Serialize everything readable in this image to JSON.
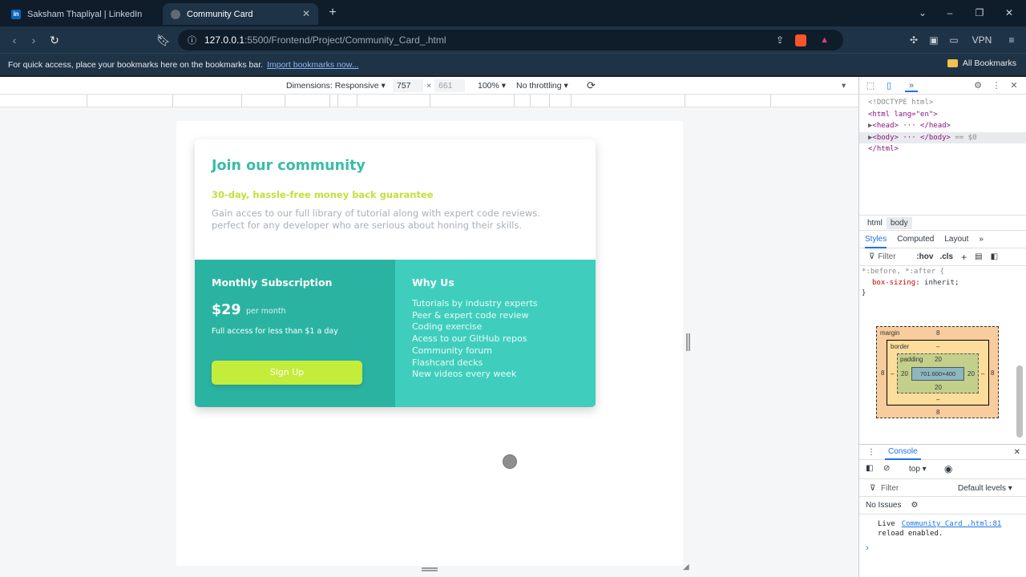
{
  "browser": {
    "tabs": [
      {
        "title": "Saksham Thapliyal | LinkedIn",
        "icon": "linkedin-icon",
        "active": false
      },
      {
        "title": "Community Card",
        "icon": "globe-icon",
        "active": true
      }
    ],
    "url_host": "127.0.0.1",
    "url_rest": ":5500/Frontend/Project/Community_Card_.html",
    "vpn_label": "VPN",
    "bookmarks_hint": "For quick access, place your bookmarks here on the bookmarks bar.",
    "import_link": "Import bookmarks now...",
    "all_bookmarks": "All Bookmarks"
  },
  "device_toolbar": {
    "dimensions_label": "Dimensions: Responsive",
    "width": "757",
    "times": "×",
    "height": "661",
    "zoom": "100%",
    "throttling": "No throttling"
  },
  "card": {
    "title": "Join our community",
    "guarantee": "30-day, hassle-free money back guarantee",
    "description": "Gain acces to our full library of tutorial along with expert code reviews. perfect for any developer who are serious about honing their skills.",
    "subscription_title": "Monthly Subscription",
    "price": "$29",
    "per_month": "per month",
    "access_text": "Full access for less than $1 a day",
    "signup_label": "Sign Up",
    "why_title": "Why Us",
    "why_items": [
      "Tutorials by industry experts",
      "Peer & expert code review",
      "Coding exercise",
      "Acess to our GitHub repos",
      "Community forum",
      "Flashcard decks",
      "New videos every week"
    ]
  },
  "devtools": {
    "dom": {
      "doctype": "<!DOCTYPE html>",
      "html_open": "<html lang=\"en\">",
      "head": "<head> ··· </head>",
      "body": "<body> ··· </body>",
      "body_note": "== $0",
      "html_close": "</html>"
    },
    "breadcrumbs": [
      "html",
      "body"
    ],
    "style_tabs": [
      "Styles",
      "Computed",
      "Layout"
    ],
    "filter_placeholder": "Filter",
    "hov": ":hov",
    "cls": ".cls",
    "rule_selector": "*:before, *:after {",
    "rule_prop": "box-sizing",
    "rule_value": "inherit;",
    "rule_close": "}",
    "box_model": {
      "margin_label": "margin",
      "margin": "8",
      "border_label": "border",
      "border": "–",
      "padding_label": "padding",
      "padding": "20",
      "content": "701.600×400"
    },
    "console": {
      "title": "Console",
      "context": "top",
      "filter_placeholder": "Filter",
      "levels": "Default levels",
      "issues": "No Issues",
      "log_text1": "Live",
      "log_link": "Community_Card_.html:81",
      "log_text2": "reload enabled."
    }
  }
}
